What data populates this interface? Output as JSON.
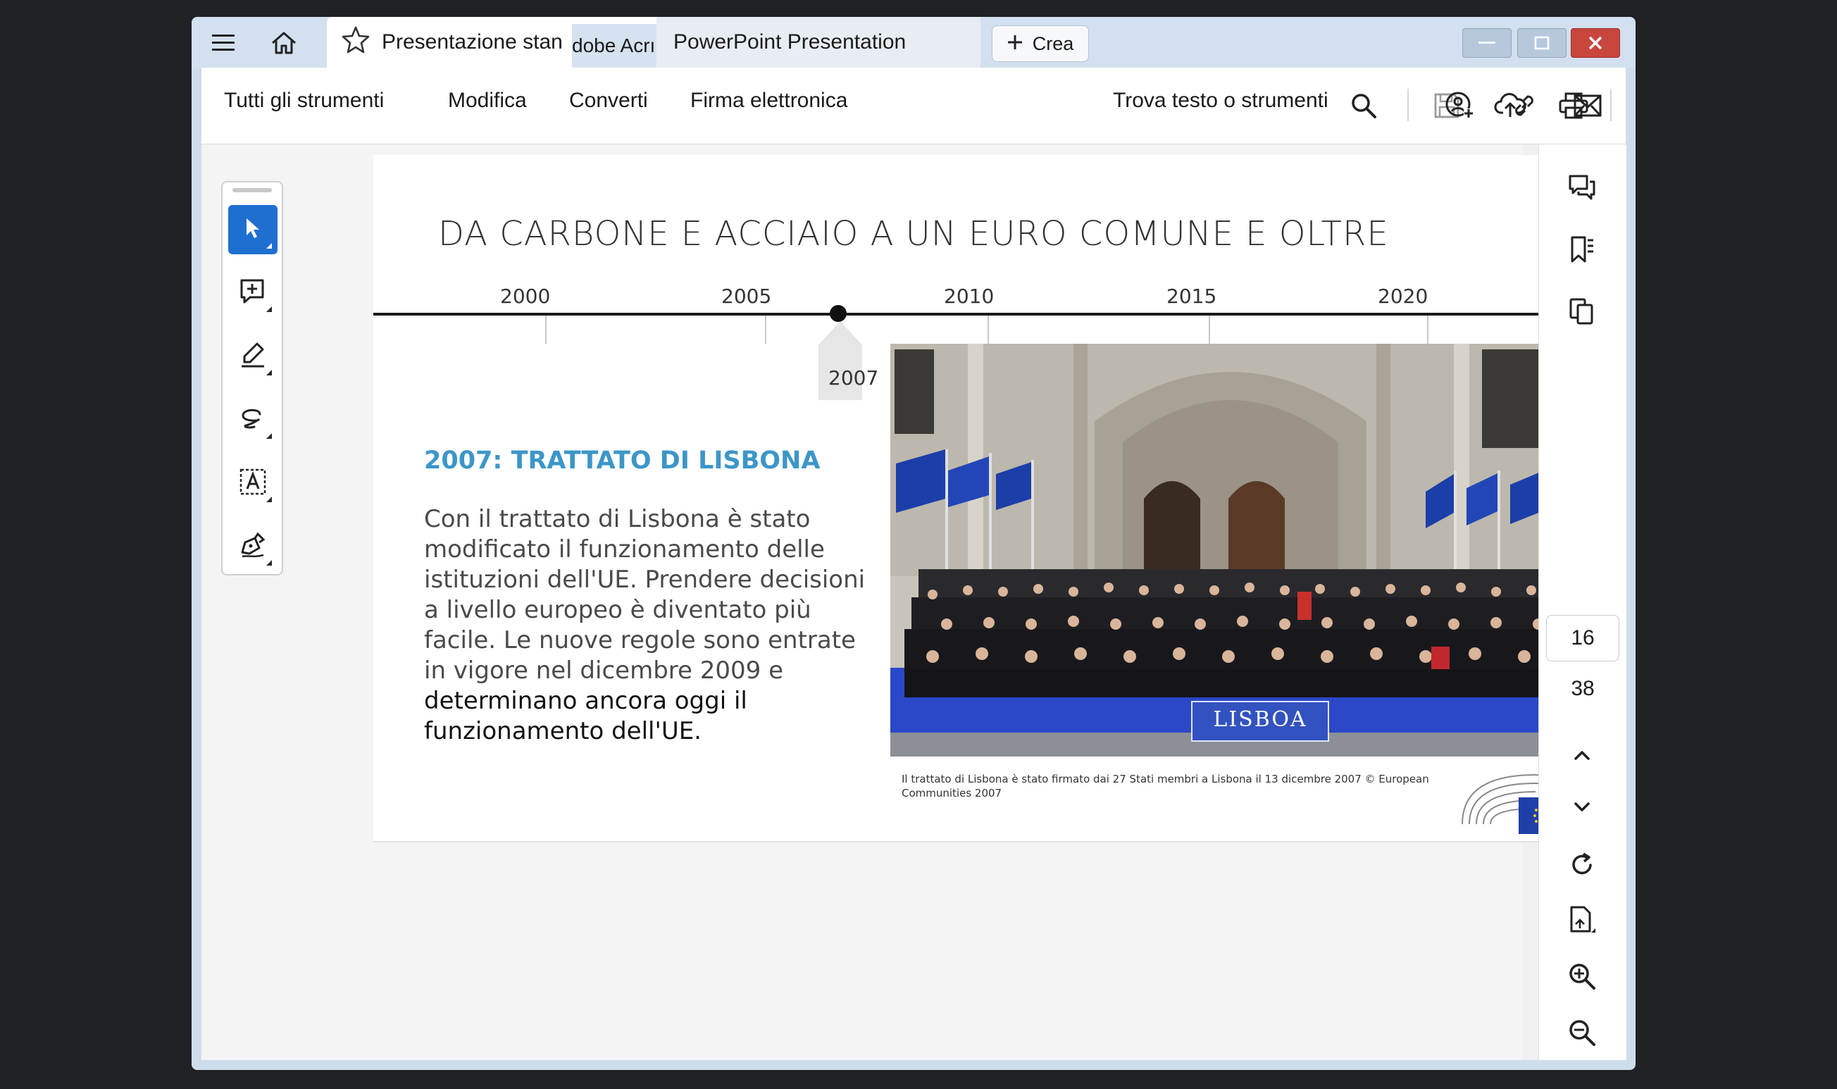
{
  "titlebar": {
    "active_tab": "Presentazione standobe Acrobat",
    "active_tab_visible": "Presentazione stan",
    "partial_tab": "dobe Acrı",
    "second_tab": "PowerPoint Presentation",
    "create_button": "Crea"
  },
  "toolbar": {
    "menu": [
      "Tutti gli strumenti",
      "Modifica",
      "Converti",
      "Firma elettronica"
    ],
    "search_label": "Trova testo o strumenti"
  },
  "slide": {
    "title": "DA CARBONE E ACCIAIO A UN EURO COMUNE E OLTRE",
    "timeline_ticks": [
      "2000",
      "2005",
      "2010",
      "2015",
      "2020"
    ],
    "timeline_marker": "2007",
    "subtitle": "2007: TRATTATO DI LISBONA",
    "body_plain": "Con il trattato di Lisbona è stato modificato il funzionamento delle istituzioni dell'UE. Prendere decisioni a livello europeo è diventato più facile. Le nuove regole sono entrate in vigore nel dicembre 2009 e ",
    "body_emph": "determinano ancora oggi il funzionamento dell'UE.",
    "photo_banner": "LISBOA",
    "caption": "Il trattato di Lisbona è stato firmato dai 27 Stati membri a Lisbona il 13 dicembre 2007 © European Communities 2007"
  },
  "pager": {
    "current_page": "16",
    "total_pages": "38"
  },
  "colors": {
    "accent_blue": "#1f6fd1",
    "subtitle_blue": "#3c96c8",
    "close_red": "#c9463d"
  }
}
